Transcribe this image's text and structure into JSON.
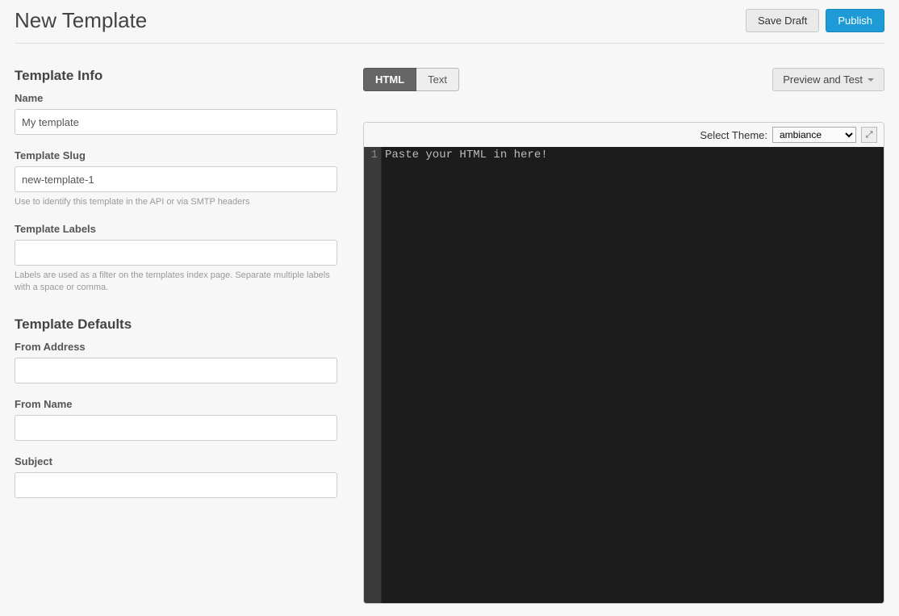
{
  "header": {
    "title": "New Template",
    "save_draft": "Save Draft",
    "publish": "Publish"
  },
  "info": {
    "heading": "Template Info",
    "name_label": "Name",
    "name_value": "My template",
    "slug_label": "Template Slug",
    "slug_value": "new-template-1",
    "slug_help": "Use to identify this template in the API or via SMTP headers",
    "labels_label": "Template Labels",
    "labels_value": "",
    "labels_help": "Labels are used as a filter on the templates index page. Separate multiple labels with a space or comma."
  },
  "defaults": {
    "heading": "Template Defaults",
    "from_address_label": "From Address",
    "from_address_value": "",
    "from_name_label": "From Name",
    "from_name_value": "",
    "subject_label": "Subject",
    "subject_value": ""
  },
  "editor": {
    "tab_html": "HTML",
    "tab_text": "Text",
    "preview_test": "Preview and Test",
    "select_theme_label": "Select Theme:",
    "theme_value": "ambiance",
    "line_number": "1",
    "content": "Paste your HTML in here!"
  }
}
